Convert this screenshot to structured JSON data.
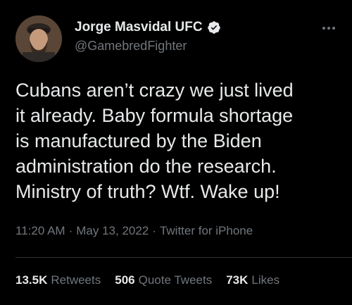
{
  "author": {
    "display_name": "Jorge Masvidal UFC",
    "handle": "@GamebredFighter"
  },
  "tweet": {
    "text": "Cubans aren’t crazy we just lived\nit already. Baby formula shortage\nis manufactured by the Biden\nadministration do the research.\nMinistry of truth? Wtf. Wake up!",
    "time": "11:20 AM",
    "date": "May 13, 2022",
    "source": "Twitter for iPhone",
    "separator": "·"
  },
  "stats": {
    "retweets_count": "13.5K",
    "retweets_label": "Retweets",
    "quote_count": "506",
    "quote_label": "Quote Tweets",
    "likes_count": "73K",
    "likes_label": "Likes"
  },
  "icons": {
    "verified": "verified-badge-icon",
    "more": "more-options-icon"
  },
  "colors": {
    "background": "#000000",
    "primary_text": "#e7e9ea",
    "secondary_text": "#71767b",
    "verified_badge": "#e7e9ea"
  }
}
